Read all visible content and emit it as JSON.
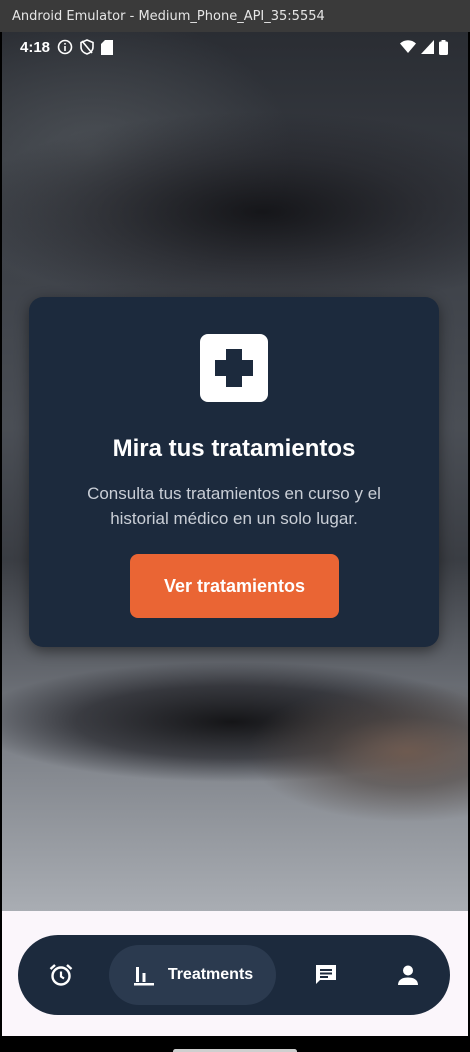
{
  "window": {
    "title": "Android Emulator - Medium_Phone_API_35:5554"
  },
  "status_bar": {
    "time": "4:18",
    "left_icons": [
      "info-icon",
      "shield-icon",
      "sd-card-icon"
    ],
    "right_icons": [
      "wifi-icon",
      "signal-icon",
      "battery-icon"
    ]
  },
  "card": {
    "icon": "medical-cross-icon",
    "title": "Mira tus tratamientos",
    "description": "Consulta tus tratamientos en curso y el historial médico en un solo lugar.",
    "button_label": "Ver tratamientos"
  },
  "bottom_nav": {
    "items": [
      {
        "icon": "alarm-icon",
        "label": ""
      },
      {
        "icon": "chart-bars-icon",
        "label": "Treatments",
        "active": true
      },
      {
        "icon": "chat-icon",
        "label": ""
      },
      {
        "icon": "person-icon",
        "label": ""
      }
    ]
  },
  "colors": {
    "card_bg": "#1c2a3d",
    "accent": "#ea6534",
    "nav_active_bg": "#2b3a4f"
  }
}
